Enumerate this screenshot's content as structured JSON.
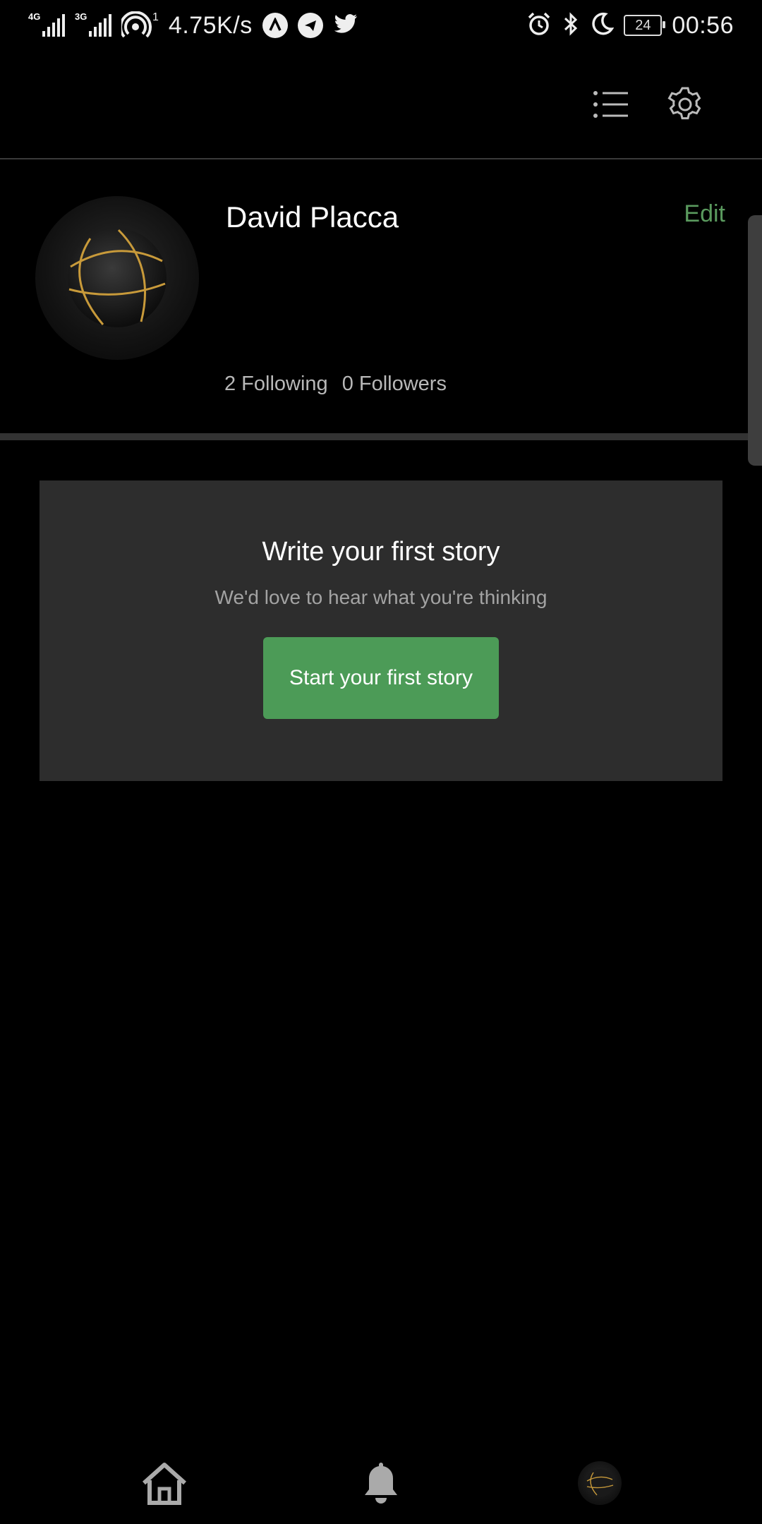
{
  "status_bar": {
    "network_1": "4G",
    "network_2": "3G",
    "hotspot_count": "1",
    "speed": "4.75K/s",
    "battery": "24",
    "time": "00:56",
    "notification_icons": [
      "navigation-icon",
      "telegram-icon",
      "twitter-icon"
    ],
    "status_icons": [
      "alarm-icon",
      "bluetooth-icon",
      "moon-icon"
    ]
  },
  "toolbar": {
    "list_icon": "list-icon",
    "settings_icon": "gear-icon"
  },
  "profile": {
    "name": "David Placca",
    "edit_label": "Edit",
    "following": "2 Following",
    "followers": "0 Followers"
  },
  "story_card": {
    "title": "Write your first story",
    "subtitle": "We'd love to hear what you're thinking",
    "button_label": "Start your first story"
  },
  "bottom_nav": {
    "items": [
      "home-icon",
      "bell-icon",
      "avatar"
    ]
  },
  "colors": {
    "background": "#000000",
    "accent": "#4c9b57",
    "edit": "#5a9a5e",
    "card": "#2d2d2d"
  }
}
